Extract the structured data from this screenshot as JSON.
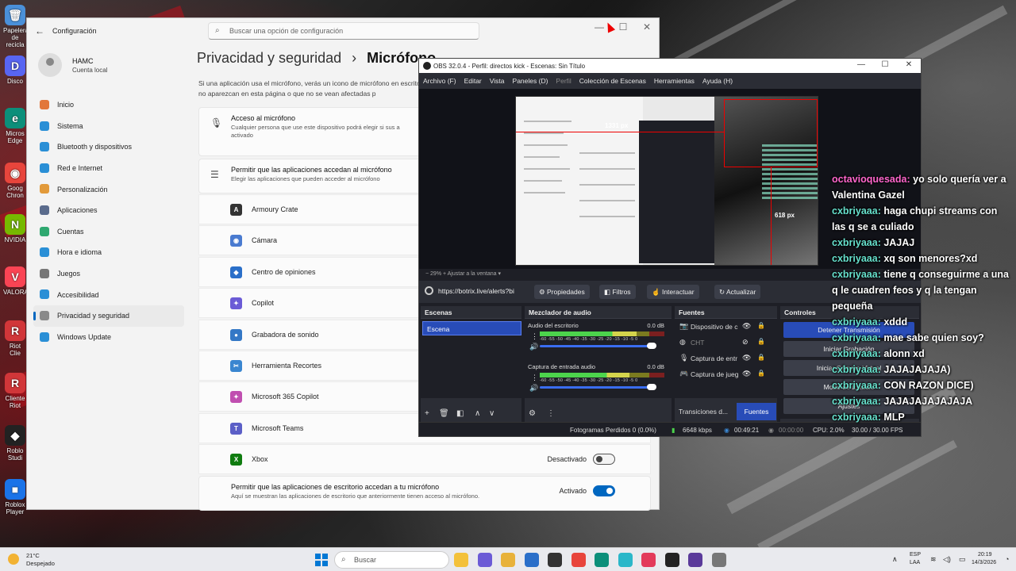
{
  "desktop_icons": [
    {
      "label": "Papelera de recicla",
      "icon": "recycle-bin-icon",
      "color": "#4a90d9",
      "glyph": "🗑"
    },
    {
      "label": "Disco",
      "icon": "discord-icon",
      "color": "#5865f2",
      "glyph": "D"
    },
    {
      "label": "Micros Edge",
      "icon": "edge-icon",
      "color": "#0c8f7a",
      "glyph": "e"
    },
    {
      "label": "Goog Chron",
      "icon": "chrome-icon",
      "color": "#e8453c",
      "glyph": "◉"
    },
    {
      "label": "NVIDIA",
      "icon": "nvidia-icon",
      "color": "#76b900",
      "glyph": "N"
    },
    {
      "label": "VALORA",
      "icon": "valorant-icon",
      "color": "#fa4454",
      "glyph": "V"
    },
    {
      "label": "Riot Clie",
      "icon": "riot-client-icon",
      "color": "#d13639",
      "glyph": "R"
    },
    {
      "label": "Cliente Riot",
      "icon": "riot-client-icon",
      "color": "#d13639",
      "glyph": "R"
    },
    {
      "label": "Roblo Studi",
      "icon": "roblox-studio-icon",
      "color": "#222",
      "glyph": "◆"
    },
    {
      "label": "Roblox Player",
      "icon": "roblox-player-icon",
      "color": "#1a73e8",
      "glyph": "■"
    }
  ],
  "settings": {
    "app_title": "Configuración",
    "search_placeholder": "Buscar una opción de configuración",
    "user_name": "HAMC",
    "user_sub": "Cuenta local",
    "nav": [
      {
        "label": "Inicio",
        "icon": "home-icon",
        "color": "#e2773a"
      },
      {
        "label": "Sistema",
        "icon": "system-icon",
        "color": "#2a8fd6"
      },
      {
        "label": "Bluetooth y dispositivos",
        "icon": "bluetooth-icon",
        "color": "#2a8fd6"
      },
      {
        "label": "Red e Internet",
        "icon": "wifi-icon",
        "color": "#2a8fd6"
      },
      {
        "label": "Personalización",
        "icon": "brush-icon",
        "color": "#e29a3a"
      },
      {
        "label": "Aplicaciones",
        "icon": "apps-icon",
        "color": "#5a6b8c"
      },
      {
        "label": "Cuentas",
        "icon": "account-icon",
        "color": "#2fa870"
      },
      {
        "label": "Hora e idioma",
        "icon": "globe-icon",
        "color": "#2a8fd6"
      },
      {
        "label": "Juegos",
        "icon": "gamepad-icon",
        "color": "#777"
      },
      {
        "label": "Accesibilidad",
        "icon": "accessibility-icon",
        "color": "#2a8fd6"
      },
      {
        "label": "Privacidad y seguridad",
        "icon": "shield-icon",
        "color": "#8a8a8a"
      },
      {
        "label": "Windows Update",
        "icon": "update-icon",
        "color": "#2a8fd6"
      }
    ],
    "breadcrumb_parent": "Privacidad y seguridad",
    "breadcrumb_sep": "›",
    "breadcrumb_current": "Micrófono",
    "intro": "Si una aplicación usa el micrófono, verás un icono de micrófono en escritorio no aparezcan en esta página o que no se vean afectadas p",
    "access_title": "Acceso al micrófono",
    "access_sub": "Cualquier persona que use este dispositivo podrá elegir si sus a activado",
    "allow_title": "Permitir que las aplicaciones accedan al micrófono",
    "allow_sub": "Elegir las aplicaciones que pueden acceder al micrófono",
    "apps": [
      {
        "name": "Armoury Crate",
        "icon": "armoury-crate-icon",
        "color": "#333",
        "glyph": "A"
      },
      {
        "name": "Cámara",
        "icon": "camera-icon",
        "color": "#4a7bd0",
        "glyph": "◉"
      },
      {
        "name": "Centro de opiniones",
        "icon": "feedback-icon",
        "color": "#2a6fc9",
        "glyph": "◆"
      },
      {
        "name": "Copilot",
        "icon": "copilot-icon",
        "color": "#6b5bd6",
        "glyph": "✦"
      },
      {
        "name": "Grabadora de sonido",
        "icon": "sound-recorder-icon",
        "color": "#3478c6",
        "glyph": "●"
      },
      {
        "name": "Herramienta Recortes",
        "icon": "snipping-tool-icon",
        "color": "#3a86d0",
        "glyph": "✂"
      },
      {
        "name": "Microsoft 365 Copilot",
        "icon": "m365-copilot-icon",
        "color": "#c04fb0",
        "glyph": "✦"
      },
      {
        "name": "Microsoft Teams",
        "icon": "teams-icon",
        "color": "#5b5fc7",
        "glyph": "T"
      },
      {
        "name": "Xbox",
        "icon": "xbox-icon",
        "color": "#107c10",
        "glyph": "X"
      }
    ],
    "xbox_toggle_label": "Desactivado",
    "desktop_title": "Permitir que las aplicaciones de escritorio accedan a tu micrófono",
    "desktop_sub": "Aquí se muestran las aplicaciones de escritorio que anteriormente tienen acceso al micrófono.",
    "desktop_toggle_label": "Activado"
  },
  "obs": {
    "title": "OBS 32.0.4 - Perfil: directos kick - Escenas: Sin Título",
    "menu": [
      "Archivo (F)",
      "Editar",
      "Vista",
      "Paneles (D)",
      "Perfil",
      "Colección de Escenas",
      "Herramientas",
      "Ayuda (H)"
    ],
    "px_label_1": "1331 px",
    "px_label_2": "618 px",
    "zoom_text": "−   29%   +   Ajustar a la ventana  ▾",
    "source_url": "https://botrix.live/alerts?bi",
    "btn_properties": "Propiedades",
    "btn_filters": "Filtros",
    "btn_interact": "Interactuar",
    "btn_refresh": "Actualizar",
    "scenes_title": "Escenas",
    "scene_item": "Escena",
    "mixer_title": "Mezclador de audio",
    "channels": [
      {
        "name": "Audio del escritorio",
        "db": "0.0 dB",
        "level": 0.78
      },
      {
        "name": "Captura de entrada audio",
        "db": "0.0 dB",
        "level": 0.72
      }
    ],
    "tick_text": "-60 -55 -50 -45 -40 -35 -30 -25 -20 -15 -10 -5 0",
    "sources_title": "Fuentes",
    "sources": [
      {
        "name": "Dispositivo de c",
        "icon": "camera-icon",
        "visible": true
      },
      {
        "name": "CHT",
        "icon": "browser-icon",
        "visible": false
      },
      {
        "name": "Captura de entr",
        "icon": "microphone-icon",
        "visible": true
      },
      {
        "name": "Captura de jueg",
        "icon": "gamepad-icon",
        "visible": true
      }
    ],
    "controls_title": "Controles",
    "controls": [
      "Detener Transmisión",
      "Iniciar Grabación",
      "Iniciar Cámara Virtual",
      "Modo de Estudio",
      "Ajustes"
    ],
    "tab_transitions": "Transiciones d...",
    "tab_sources": "Fuentes",
    "status_dropped": "Fotogramas Perdidos 0 (0.0%)",
    "status_kbps": "6648 kbps",
    "status_stream_time": "00:49:21",
    "status_rec_time": "00:00:00",
    "status_cpu": "CPU: 2.0%",
    "status_fps": "30.00 / 30.00 FPS"
  },
  "chat": [
    {
      "user": "octavioquesada",
      "msg": "yo solo quería ver a Valentina Gazel",
      "color": "u1"
    },
    {
      "user": "cxbriyaaa",
      "msg": "haga chupi streams con las q se a culiado",
      "color": "u2"
    },
    {
      "user": "cxbriyaaa",
      "msg": "JAJAJ",
      "color": "u2"
    },
    {
      "user": "cxbriyaaa",
      "msg": "xq son menores?xd",
      "color": "u2"
    },
    {
      "user": "cxbriyaaa",
      "msg": "tiene q conseguirme a una q le cuadren feos y q la tengan pequeña",
      "color": "u2"
    },
    {
      "user": "cxbriyaaa",
      "msg": "xddd",
      "color": "u2"
    },
    {
      "user": "cxbriyaaa",
      "msg": "mae sabe quien soy?",
      "color": "u2"
    },
    {
      "user": "cxbriyaaa",
      "msg": "alonn xd",
      "color": "u2"
    },
    {
      "user": "cxbriyaaa",
      "msg": "JAJAJAJAJA)",
      "color": "u2"
    },
    {
      "user": "cxbriyaaa",
      "msg": "CON RAZON DICE)",
      "color": "u2"
    },
    {
      "user": "cxbriyaaa",
      "msg": "JAJAJAJAJAJAJA",
      "color": "u2"
    },
    {
      "user": "cxbriyaaa",
      "msg": "MLP",
      "color": "u2"
    }
  ],
  "taskbar": {
    "temp": "21°C",
    "weather": "Despejado",
    "search": "Buscar",
    "apps": [
      {
        "icon": "file-explorer-icon",
        "color": "#f3c13a"
      },
      {
        "icon": "copilot-icon",
        "color": "#6b5bd6"
      },
      {
        "icon": "folder-icon",
        "color": "#e8b23a"
      },
      {
        "icon": "store-icon",
        "color": "#2a6fc9"
      },
      {
        "icon": "vscode-icon",
        "color": "#333"
      },
      {
        "icon": "chrome-icon",
        "color": "#e8453c"
      },
      {
        "icon": "edge-icon",
        "color": "#0c8f7a"
      },
      {
        "icon": "figma-icon",
        "color": "#2ab7c9"
      },
      {
        "icon": "music-icon",
        "color": "#e33a5a"
      },
      {
        "icon": "obs-icon",
        "color": "#222"
      },
      {
        "icon": "app-icon",
        "color": "#5a3a9a"
      },
      {
        "icon": "settings-icon",
        "color": "#777"
      }
    ],
    "lang": "ESP",
    "lang2": "LAA",
    "time": "20:19",
    "date": "14/3/2026"
  }
}
